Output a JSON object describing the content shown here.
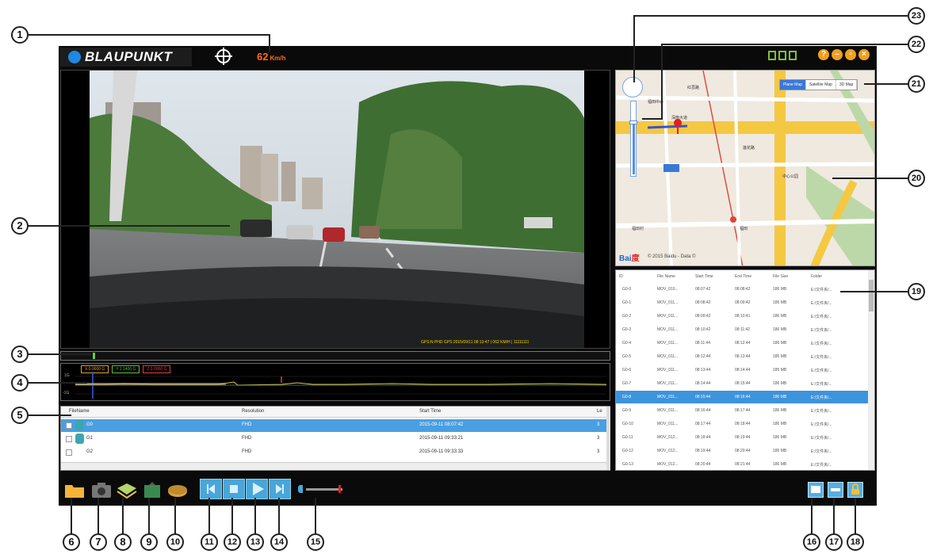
{
  "app": {
    "brand": "BLAUPUNKT",
    "speed": "62",
    "speed_unit": "Km/h"
  },
  "video": {
    "overlay": "GPS:N PHD GPS:2015/09/11 08:13:47 | 062 KM/H | 11111111"
  },
  "graph": {
    "tags": [
      {
        "label": "X:0.0000 G",
        "color": "#e0a030"
      },
      {
        "label": "Y:1.1400 G",
        "color": "#58c040"
      },
      {
        "label": "Z:0.0000 G",
        "color": "#e04040"
      }
    ],
    "axis_top": "1G",
    "axis_bottom": "-1G"
  },
  "file_table": {
    "columns": [
      "FileName",
      "Resolution",
      "Start Time",
      "Le"
    ],
    "rows": [
      {
        "name": "G0",
        "resolution": "FHD",
        "start": "2015-09-11 08:07:42",
        "le": "3",
        "selected": true
      },
      {
        "name": "G1",
        "resolution": "FHD",
        "start": "2015-09-11 09:33:21",
        "le": "3",
        "selected": false
      },
      {
        "name": "G2",
        "resolution": "FHD",
        "start": "2015-09-11 09:33:33",
        "le": "3",
        "selected": false
      }
    ]
  },
  "map": {
    "types": [
      "Plane Map",
      "Satellite Map",
      "3D Map"
    ],
    "active_type": "Plane Map",
    "logo_a": "Bai",
    "logo_b": "度",
    "copyright": "© 2015 Baidu - Data ©",
    "labels": [
      "深南大道",
      "福田中心",
      "福田",
      "莲花路",
      "红荔路",
      "中心公园",
      "福田村"
    ]
  },
  "files_list": {
    "columns": [
      "ID",
      "File Name",
      "Start Time",
      "End Time",
      "File Size",
      "Folder"
    ],
    "rows": [
      [
        "G0-0",
        "MOV_010...",
        "08:07:42",
        "08:08:42",
        "186 MB",
        "E:/文件夹/..."
      ],
      [
        "G0-1",
        "MOV_011...",
        "08:08:42",
        "08:09:42",
        "186 MB",
        "E:/文件夹/..."
      ],
      [
        "G0-2",
        "MOV_011...",
        "08:09:42",
        "08:10:41",
        "186 MB",
        "E:/文件夹/..."
      ],
      [
        "G0-3",
        "MOV_011...",
        "08:10:42",
        "08:11:42",
        "186 MB",
        "E:/文件夹/..."
      ],
      [
        "G0-4",
        "MOV_011...",
        "08:11:44",
        "08:12:44",
        "186 MB",
        "E:/文件夹/..."
      ],
      [
        "G0-5",
        "MOV_011...",
        "08:12:44",
        "08:13:44",
        "185 MB",
        "E:/文件夹/..."
      ],
      [
        "G0-6",
        "MOV_011...",
        "08:13:44",
        "08:14:44",
        "185 MB",
        "E:/文件夹/..."
      ],
      [
        "G0-7",
        "MOV_011...",
        "08:14:44",
        "08:15:44",
        "186 MB",
        "E:/文件夹/..."
      ],
      [
        "G0-8",
        "MOV_011...",
        "08:15:44",
        "08:16:44",
        "186 MB",
        "E:/文件夹/..."
      ],
      [
        "G0-9",
        "MOV_011...",
        "08:16:44",
        "08:17:44",
        "186 MB",
        "E:/文件夹/..."
      ],
      [
        "G0-10",
        "MOV_011...",
        "08:17:44",
        "08:18:44",
        "186 MB",
        "E:/文件夹/..."
      ],
      [
        "G0-11",
        "MOV_012...",
        "08:18:44",
        "08:19:44",
        "186 MB",
        "E:/文件夹/..."
      ],
      [
        "G0-12",
        "MOV_012...",
        "08:19:44",
        "08:20:44",
        "186 MB",
        "E:/文件夹/..."
      ],
      [
        "G0-13",
        "MOV_012...",
        "08:20:44",
        "08:21:44",
        "186 MB",
        "E:/文件夹/..."
      ]
    ],
    "selected_row": 8
  },
  "toolbar": {
    "icons": [
      "folder-icon",
      "camera-icon",
      "map-icon",
      "export-icon",
      "disk-icon"
    ],
    "playback": [
      "previous-icon",
      "stop-icon",
      "play-icon",
      "next-icon"
    ],
    "right_icons": [
      "screen-icon",
      "settings-icon",
      "lock-icon"
    ],
    "volume": 0.95
  },
  "callouts": [
    "1",
    "2",
    "3",
    "4",
    "5",
    "6",
    "7",
    "8",
    "9",
    "10",
    "11",
    "12",
    "13",
    "14",
    "15",
    "16",
    "17",
    "18",
    "19",
    "20",
    "21",
    "22",
    "23"
  ],
  "colors": {
    "accent": "#48a6d8",
    "selection": "#3d93dc",
    "speed": "#ff6a1f",
    "window_bg": "#0a0a0a"
  }
}
